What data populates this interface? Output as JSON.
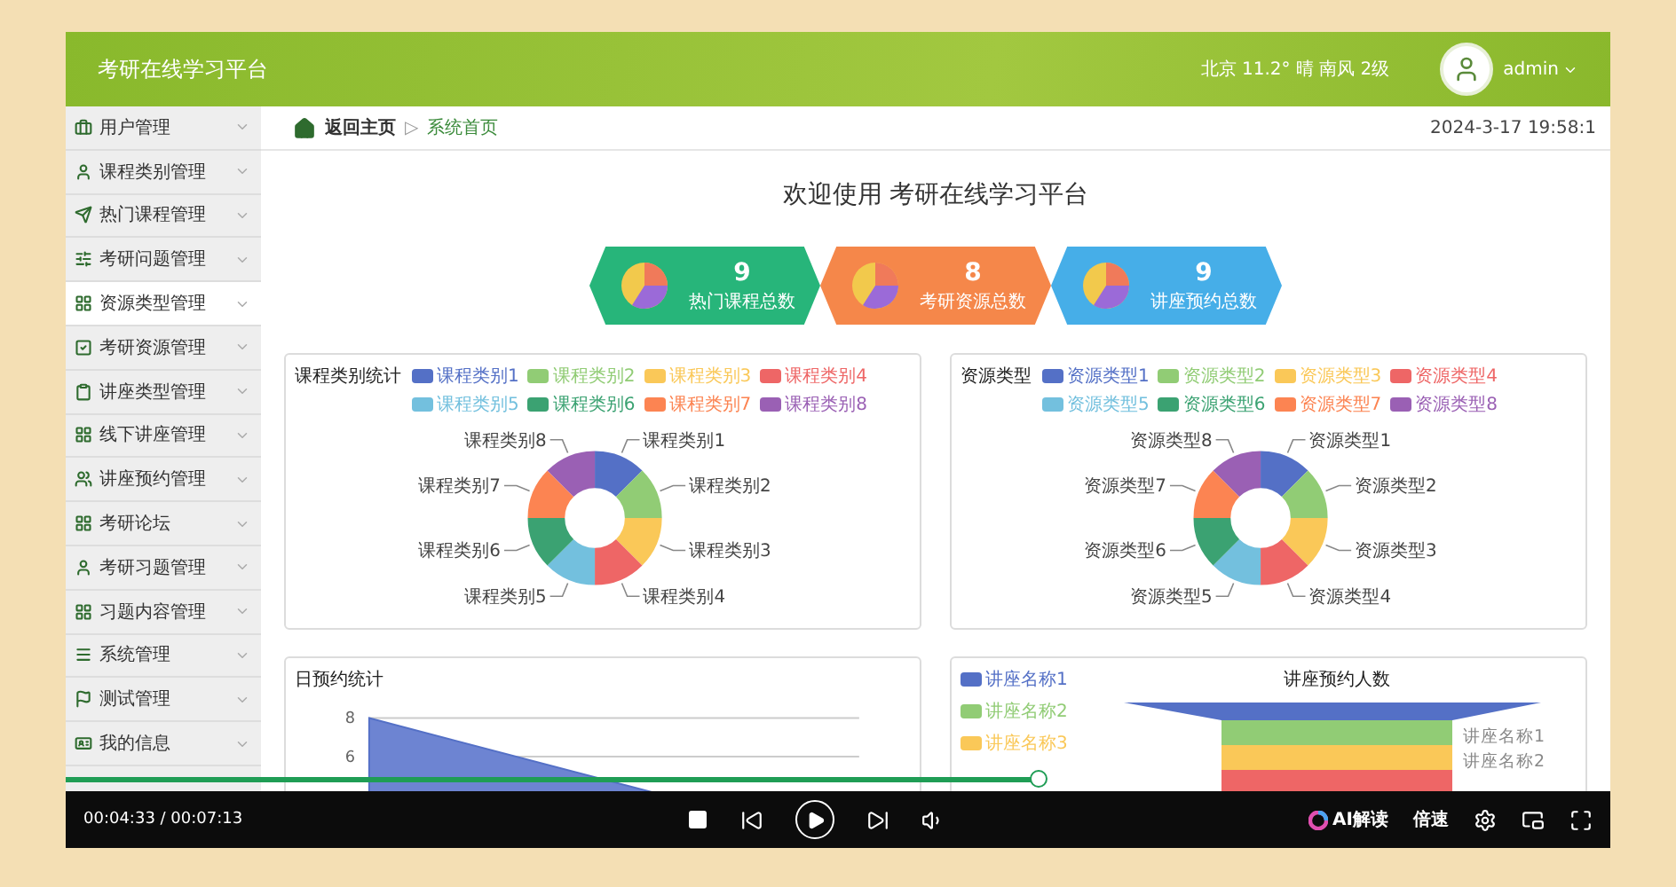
{
  "header": {
    "title": "考研在线学习平台",
    "weather": "北京 11.2° 晴 南风 2级",
    "user": "admin"
  },
  "sidebar": {
    "items": [
      {
        "label": "用户管理",
        "selected": false
      },
      {
        "label": "课程类别管理",
        "selected": false
      },
      {
        "label": "热门课程管理",
        "selected": false
      },
      {
        "label": "考研问题管理",
        "selected": false
      },
      {
        "label": "资源类型管理",
        "selected": true
      },
      {
        "label": "考研资源管理",
        "selected": false
      },
      {
        "label": "讲座类型管理",
        "selected": false
      },
      {
        "label": "线下讲座管理",
        "selected": false
      },
      {
        "label": "讲座预约管理",
        "selected": false
      },
      {
        "label": "考研论坛",
        "selected": false
      },
      {
        "label": "考研习题管理",
        "selected": false
      },
      {
        "label": "习题内容管理",
        "selected": false
      },
      {
        "label": "系统管理",
        "selected": false
      },
      {
        "label": "测试管理",
        "selected": false
      },
      {
        "label": "我的信息",
        "selected": false
      }
    ]
  },
  "breadcrumb": {
    "home": "返回主页",
    "separator": "▷",
    "current": "系统首页",
    "datetime": "2024-3-17 19:58:1"
  },
  "welcome": "欢迎使用 考研在线学习平台",
  "stats": [
    {
      "value": "9",
      "label": "热门课程总数",
      "color": "#27b57a"
    },
    {
      "value": "8",
      "label": "考研资源总数",
      "color": "#f5874a"
    },
    {
      "value": "9",
      "label": "讲座预约总数",
      "color": "#46aee8"
    }
  ],
  "charts": [
    {
      "kind": "donut",
      "title": "课程类别统计",
      "legend": [
        {
          "label": "课程类别1",
          "color": "#5470c6"
        },
        {
          "label": "课程类别2",
          "color": "#91cc75"
        },
        {
          "label": "课程类别3",
          "color": "#fac858"
        },
        {
          "label": "课程类别4",
          "color": "#ee6666"
        },
        {
          "label": "课程类别5",
          "color": "#73c0de"
        },
        {
          "label": "课程类别6",
          "color": "#3ba272"
        },
        {
          "label": "课程类别7",
          "color": "#fc8452"
        },
        {
          "label": "课程类别8",
          "color": "#9a60b4"
        }
      ],
      "slice_labels": [
        "课程类别1",
        "课程类别2",
        "课程类别3",
        "课程类别4",
        "课程类别5",
        "课程类别6",
        "课程类别7",
        "课程类别8"
      ]
    },
    {
      "kind": "donut",
      "title": "资源类型",
      "legend": [
        {
          "label": "资源类型1",
          "color": "#5470c6"
        },
        {
          "label": "资源类型2",
          "color": "#91cc75"
        },
        {
          "label": "资源类型3",
          "color": "#fac858"
        },
        {
          "label": "资源类型4",
          "color": "#ee6666"
        },
        {
          "label": "资源类型5",
          "color": "#73c0de"
        },
        {
          "label": "资源类型6",
          "color": "#3ba272"
        },
        {
          "label": "资源类型7",
          "color": "#fc8452"
        },
        {
          "label": "资源类型8",
          "color": "#9a60b4"
        }
      ],
      "slice_labels": [
        "资源类型1",
        "资源类型2",
        "资源类型3",
        "资源类型4",
        "资源类型5",
        "资源类型6",
        "资源类型7",
        "资源类型8"
      ]
    },
    {
      "kind": "line",
      "title": "日预约统计",
      "yticks": [
        "8",
        "6"
      ]
    },
    {
      "kind": "funnel",
      "title": "讲座预约人数",
      "legend": [
        {
          "label": "讲座名称1",
          "color": "#5470c6"
        },
        {
          "label": "讲座名称2",
          "color": "#91cc75"
        },
        {
          "label": "讲座名称3",
          "color": "#fac858"
        }
      ],
      "stage_labels": [
        "讲座名称1",
        "讲座名称2"
      ]
    }
  ],
  "player": {
    "time": "00:04:33 / 00:07:13",
    "progress": {
      "level": 0.63
    },
    "ai_label": "AI解读",
    "speed_label": "倍速"
  }
}
